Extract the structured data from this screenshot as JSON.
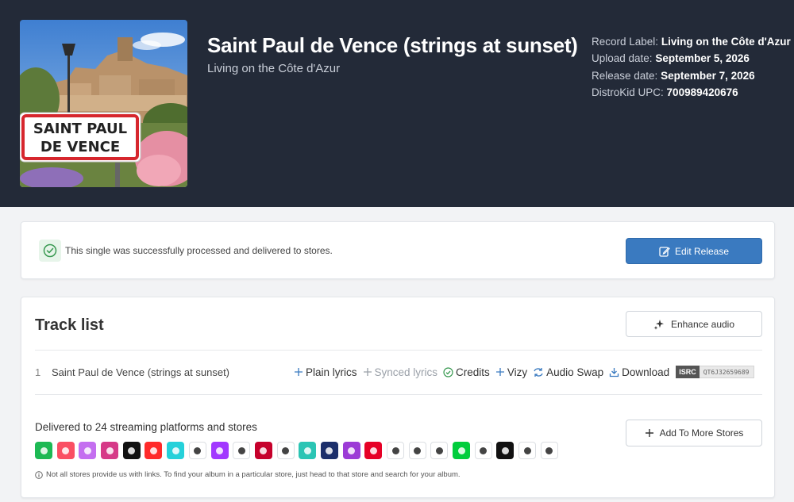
{
  "release": {
    "title": "Saint Paul de Vence (strings at sunset)",
    "artist": "Living on the Côte d'Azur",
    "cover_sign": [
      "SAINT PAUL",
      "DE VENCE"
    ],
    "meta": [
      {
        "label": "Record Label:",
        "value": "Living on the Côte d'Azur"
      },
      {
        "label": "Upload date:",
        "value": "September 5, 2026"
      },
      {
        "label": "Release date:",
        "value": "September 7, 2026"
      },
      {
        "label": "DistroKid UPC:",
        "value": "700989420676"
      }
    ]
  },
  "status": {
    "message": "This single was successfully processed and delivered to stores.",
    "edit_label": "Edit Release"
  },
  "tracklist": {
    "title": "Track list",
    "enhance_label": "Enhance audio",
    "tracks": [
      {
        "number": "1",
        "name": "Saint Paul de Vence (strings at sunset)"
      }
    ],
    "actions": {
      "plain_lyrics": "Plain lyrics",
      "synced_lyrics": "Synced lyrics",
      "credits": "Credits",
      "vizy": "Vizy",
      "audio_swap": "Audio Swap",
      "download": "Download"
    },
    "isrc_label": "ISRC",
    "isrc_code": "QT6J32659689"
  },
  "stores": {
    "delivered_text": "Delivered to 24 streaming platforms and stores",
    "add_label": "Add To More Stores",
    "note": "Not all stores provide us with links. To find your album in a particular store, just head to that store and search for your album.",
    "icons": [
      {
        "name": "spotify",
        "color": "#1db954"
      },
      {
        "name": "apple-music",
        "color": "#fa4f63"
      },
      {
        "name": "itunes",
        "color": "#c46ff0"
      },
      {
        "name": "instagram",
        "color": "#d63a88"
      },
      {
        "name": "tiktok",
        "color": "#111111"
      },
      {
        "name": "youtube-music",
        "color": "#ff2a2a"
      },
      {
        "name": "amazon-music",
        "color": "#25d1da"
      },
      {
        "name": "pandora",
        "color": "#ffffff"
      },
      {
        "name": "deezer",
        "color": "#a238ff"
      },
      {
        "name": "tidal",
        "color": "#ffffff"
      },
      {
        "name": "iheartradio",
        "color": "#c6002b"
      },
      {
        "name": "qobuz",
        "color": "#ffffff"
      },
      {
        "name": "jiosaavn",
        "color": "#2bc5b4"
      },
      {
        "name": "boomplay",
        "color": "#1c2f6b"
      },
      {
        "name": "anghami",
        "color": "#9c3bd6"
      },
      {
        "name": "netease",
        "color": "#e60026"
      },
      {
        "name": "tencent",
        "color": "#ffffff"
      },
      {
        "name": "yandex",
        "color": "#ffffff"
      },
      {
        "name": "kkbox",
        "color": "#ffffff"
      },
      {
        "name": "melon",
        "color": "#00cd3c"
      },
      {
        "name": "joox",
        "color": "#ffffff"
      },
      {
        "name": "audiomack",
        "color": "#111111"
      },
      {
        "name": "flo",
        "color": "#ffffff"
      },
      {
        "name": "mmusic",
        "color": "#ffffff"
      }
    ]
  }
}
